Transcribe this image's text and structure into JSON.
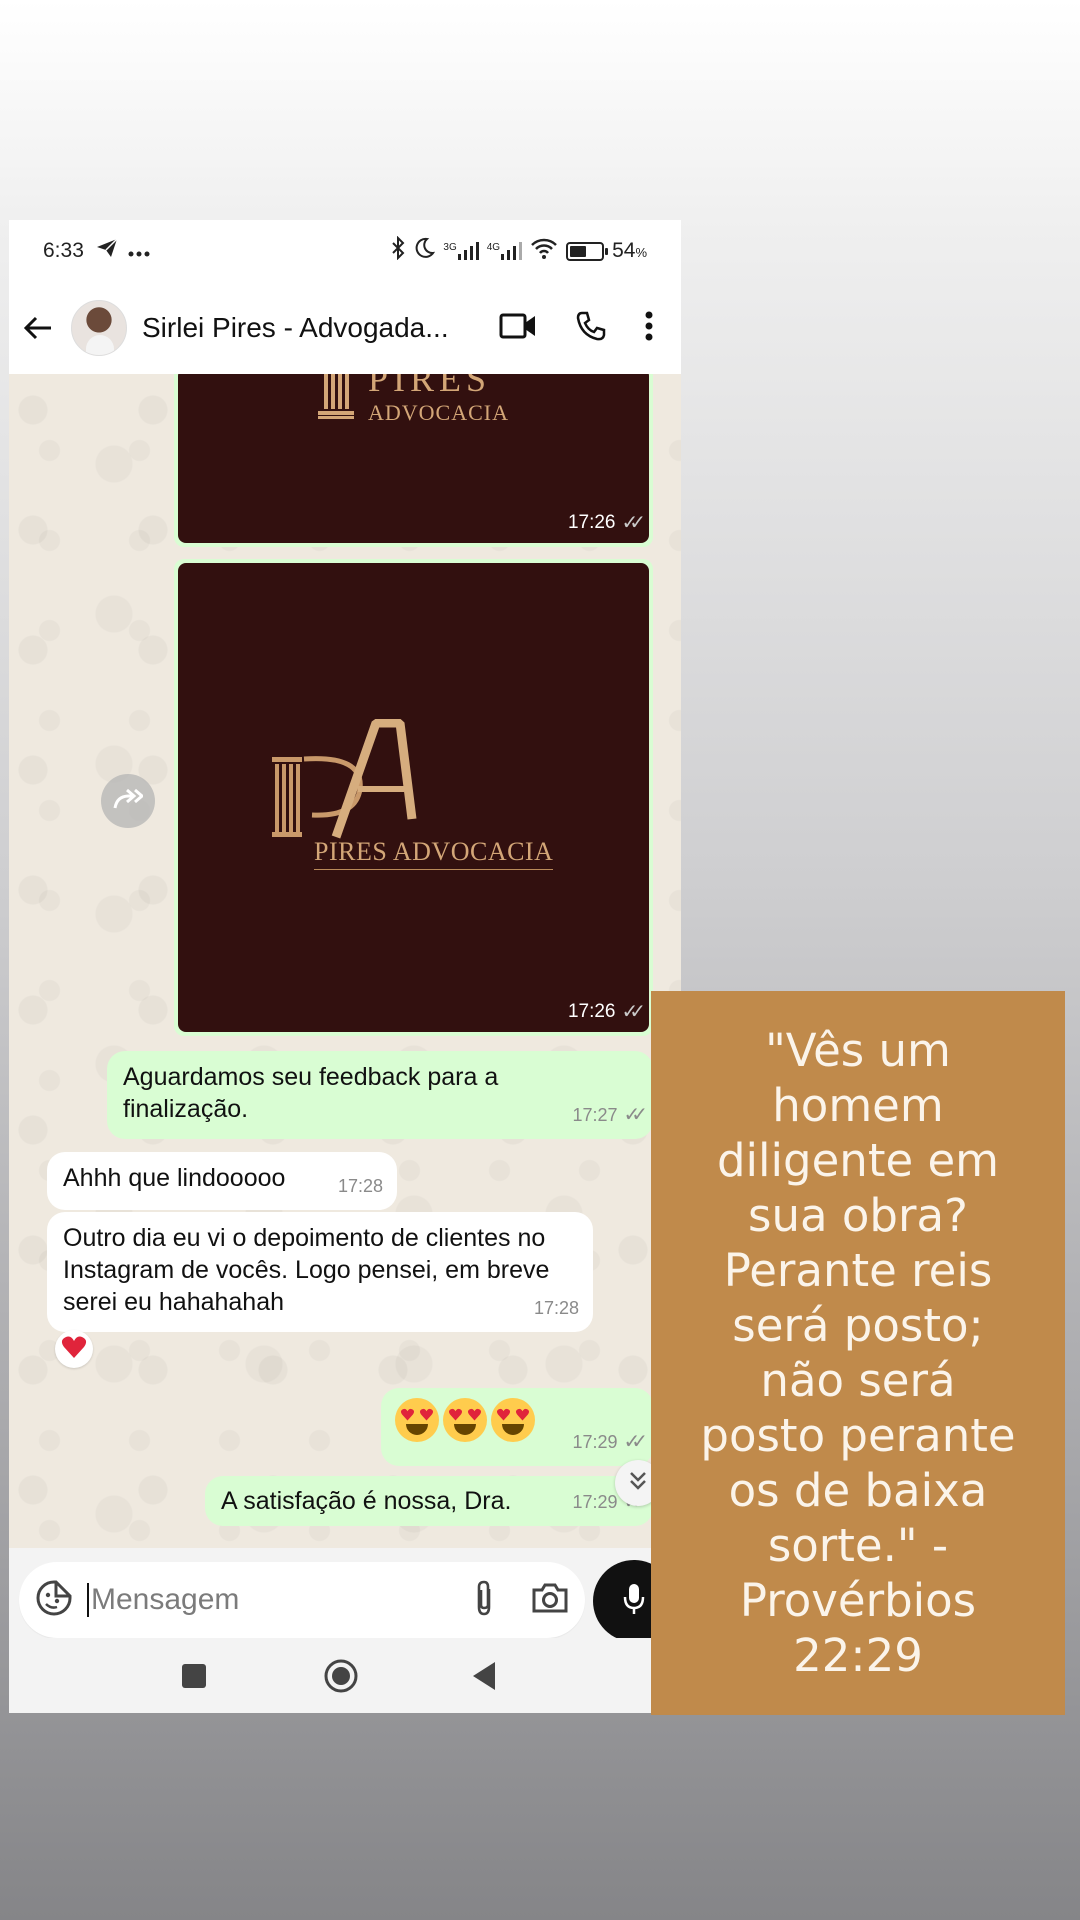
{
  "status_bar": {
    "time": "6:33",
    "network_3g": "3G",
    "network_4g": "4G",
    "battery_percent": "54",
    "battery_unit": "%"
  },
  "header": {
    "contact_name": "Sirlei Pires - Advogada..."
  },
  "chat": {
    "image_messages": [
      {
        "time": "17:26",
        "logo_line1": "PIRES",
        "logo_line2": "ADVOCACIA"
      },
      {
        "time": "17:26",
        "logo_caption": "PIRES ADVOCACIA"
      }
    ],
    "messages": [
      {
        "direction": "out",
        "text": "Aguardamos seu feedback para a finalização.",
        "time": "17:27"
      },
      {
        "direction": "in",
        "text": "Ahhh que lindooooo",
        "time": "17:28"
      },
      {
        "direction": "in",
        "text": "Outro dia eu vi o depoimento de clientes no Instagram de vocês. Logo pensei, em breve serei eu hahahahah",
        "time": "17:28",
        "reaction": "heart"
      },
      {
        "direction": "out",
        "text": "😍😍😍",
        "time": "17:29"
      },
      {
        "direction": "out",
        "text": "A satisfação é nossa, Dra.",
        "time": "17:29"
      }
    ]
  },
  "composer": {
    "placeholder": "Mensagem"
  },
  "quote": {
    "text": "\"Vês um\nhomem\ndiligente em\nsua obra?\nPerante reis\nserá posto;\nnão será\nposto perante\nos de baixa\nsorte.\" -\nProvérbios\n22:29"
  },
  "colors": {
    "outgoing_bubble": "#d9fdd3",
    "incoming_bubble": "#ffffff",
    "logo_background": "#32100f",
    "logo_gold": "#d3a677",
    "quote_background": "#c08a4b",
    "chat_background": "#efe9df"
  },
  "icons": [
    "telegram-icon",
    "more-dots-icon",
    "bluetooth-icon",
    "moon-icon",
    "signal-icon",
    "wifi-icon",
    "battery-icon",
    "back-arrow-icon",
    "video-call-icon",
    "phone-call-icon",
    "more-vert-icon",
    "forward-icon",
    "heart-icon",
    "double-chevron-down-icon",
    "sticker-icon",
    "attach-icon",
    "camera-icon",
    "mic-icon",
    "square-nav-icon",
    "home-nav-icon",
    "back-nav-icon"
  ]
}
